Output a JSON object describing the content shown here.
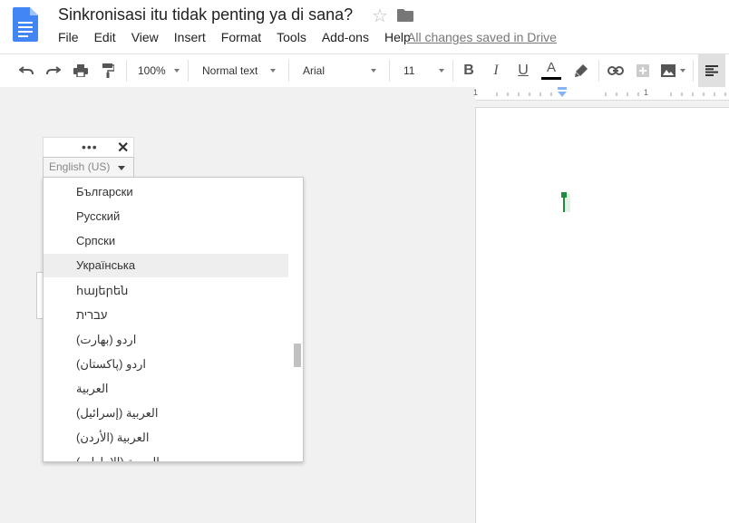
{
  "header": {
    "title": "Sinkronisasi itu tidak penting ya di sana?",
    "saved_status": "All changes saved in Drive",
    "menu": [
      "File",
      "Edit",
      "View",
      "Insert",
      "Format",
      "Tools",
      "Add-ons",
      "Help"
    ]
  },
  "toolbar": {
    "zoom": "100%",
    "style": "Normal text",
    "font": "Arial",
    "size": "11",
    "text_color": "#000000"
  },
  "ruler": {
    "marks": [
      "1",
      "1"
    ]
  },
  "language_panel": {
    "selected": "English (US)",
    "options": [
      "Български",
      "Русский",
      "Српски",
      "Українська",
      "հայերեն",
      "עברית",
      "اردو (بھارت)",
      "اردو (پاکستان)",
      "العربية",
      "العربية (إسرائيل)",
      "العربية (الأردن)",
      "العربية (الإمارات)"
    ],
    "highlighted_index": 3
  },
  "colors": {
    "accent_green": "#1e8e3e",
    "doc_blue": "#4285f4"
  }
}
